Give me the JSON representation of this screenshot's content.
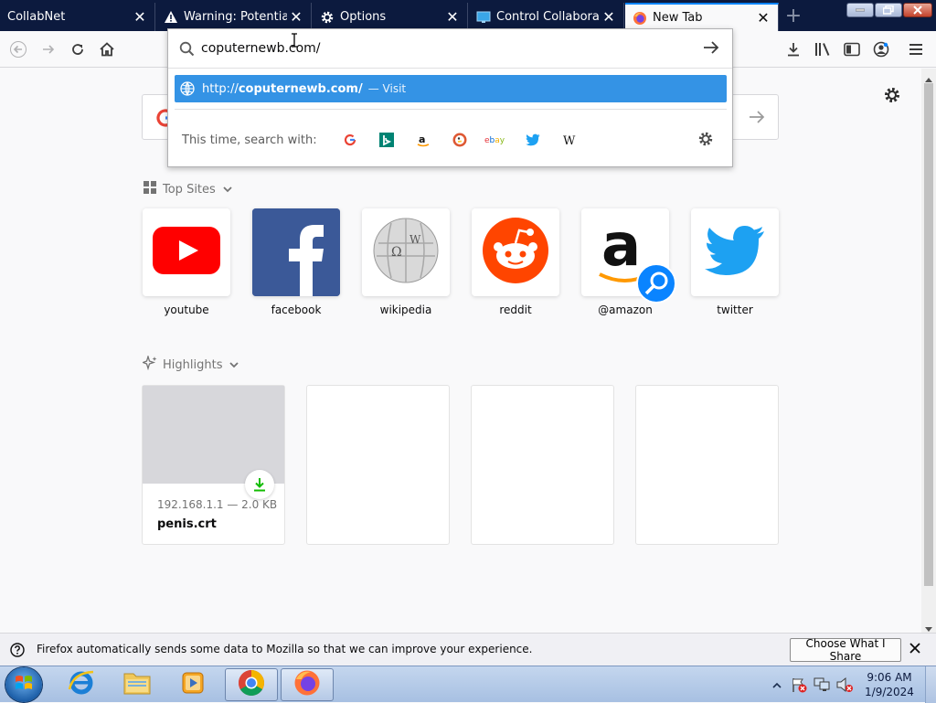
{
  "tabs": [
    {
      "label": "CollabNet",
      "icon": "none"
    },
    {
      "label": "Warning: Potential Se",
      "icon": "warning-icon"
    },
    {
      "label": "Options",
      "icon": "gear-icon"
    },
    {
      "label": "Control Collaborativ",
      "icon": "monitor-icon"
    },
    {
      "label": "New Tab",
      "icon": "firefox-icon"
    }
  ],
  "urlbar": {
    "value": "coputernewb.com/",
    "suggestion_prefix": "http://",
    "suggestion_domain": "coputernewb.com/",
    "suggestion_action": "— Visit",
    "search_with_label": "This time, search with:",
    "engines": [
      "Google",
      "Bing",
      "Amazon",
      "DuckDuckGo",
      "ebay",
      "Twitter",
      "Wikipedia"
    ]
  },
  "top_sites": {
    "title": "Top Sites",
    "sites": [
      "youtube",
      "facebook",
      "wikipedia",
      "reddit",
      "@amazon",
      "twitter"
    ]
  },
  "highlights": {
    "title": "Highlights",
    "card": {
      "source": "192.168.1.1 — 2.0 KB",
      "title": "penis.crt"
    }
  },
  "notification": {
    "text": "Firefox automatically sends some data to Mozilla so that we can improve your experience.",
    "button": "Choose What I Share"
  },
  "taskbar": {
    "time": "9:06 AM",
    "date": "1/9/2024"
  },
  "colors": {
    "accent": "#0a84ff",
    "suggestion_bg": "#3493e5",
    "tabstrip_bg": "#0c1a3e"
  }
}
